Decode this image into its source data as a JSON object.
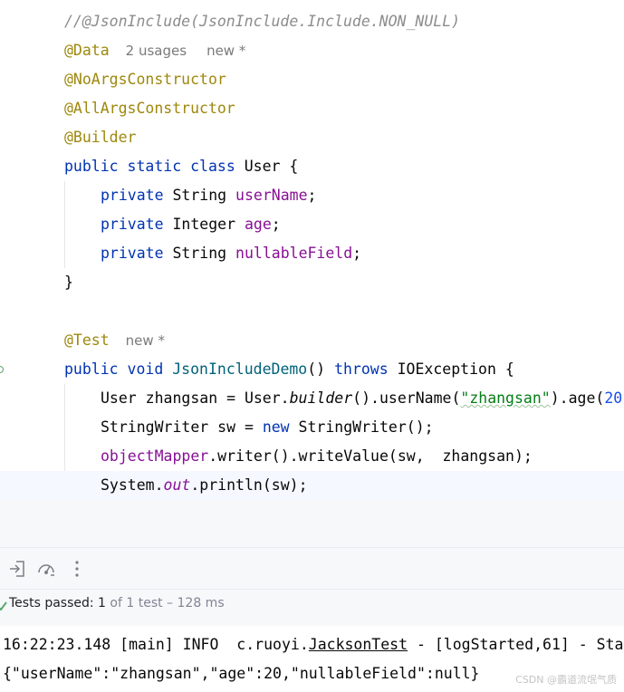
{
  "editor": {
    "comment": "//@JsonInclude(JsonInclude.Include.NON_NULL)",
    "annot_data": "@Data",
    "annot_data_usages": "2 usages",
    "annot_data_new": "new *",
    "annot_noargs": "@NoArgsConstructor",
    "annot_allargs": "@AllArgsConstructor",
    "annot_builder": "@Builder",
    "kw_public": "public",
    "kw_static": "static",
    "kw_class": "class",
    "class_name": "User",
    "brace_open": "{",
    "kw_private": "private",
    "type_string": "String",
    "type_integer": "Integer",
    "field_username": "userName",
    "field_age": "age",
    "field_nullable": "nullableField",
    "semicolon": ";",
    "brace_close": "}",
    "annot_test": "@Test",
    "annot_test_new": "new *",
    "kw_void": "void",
    "method_name": "JsonIncludeDemo",
    "parens": "()",
    "kw_throws": "throws",
    "exception_type": "IOException",
    "line_user_a": "User zhangsan = User.",
    "line_user_builder": "builder",
    "line_user_b": "().userName(",
    "line_user_str": "\"zhangsan\"",
    "line_user_c": ").age(",
    "line_user_num": "20",
    "line_sw_a": "StringWriter sw = ",
    "kw_new": "new",
    "line_sw_b": " StringWriter();",
    "line_om_field": "objectMapper",
    "line_om_rest": ".writer().writeValue(sw,  zhangsan);",
    "line_sys_a": "System.",
    "line_sys_out": "out",
    "line_sys_b": ".println(sw);"
  },
  "toolbar": {
    "icons": [
      "import-icon",
      "speedometer-icon",
      "more-vertical-icon"
    ]
  },
  "tests": {
    "passed_label": "Tests passed:",
    "passed_count": "1",
    "detail": "of 1 test – 128 ms",
    "status_color": "#59a869"
  },
  "console": {
    "log_a": "16:22:23.148 [main] INFO  c.ruoyi.",
    "log_link": "JacksonTest",
    "log_b": " - [logStarted,61] - Sta",
    "output": "{\"userName\":\"zhangsan\",\"age\":20,\"nullableField\":null}"
  },
  "watermark": "CSDN @霸道流氓气质"
}
